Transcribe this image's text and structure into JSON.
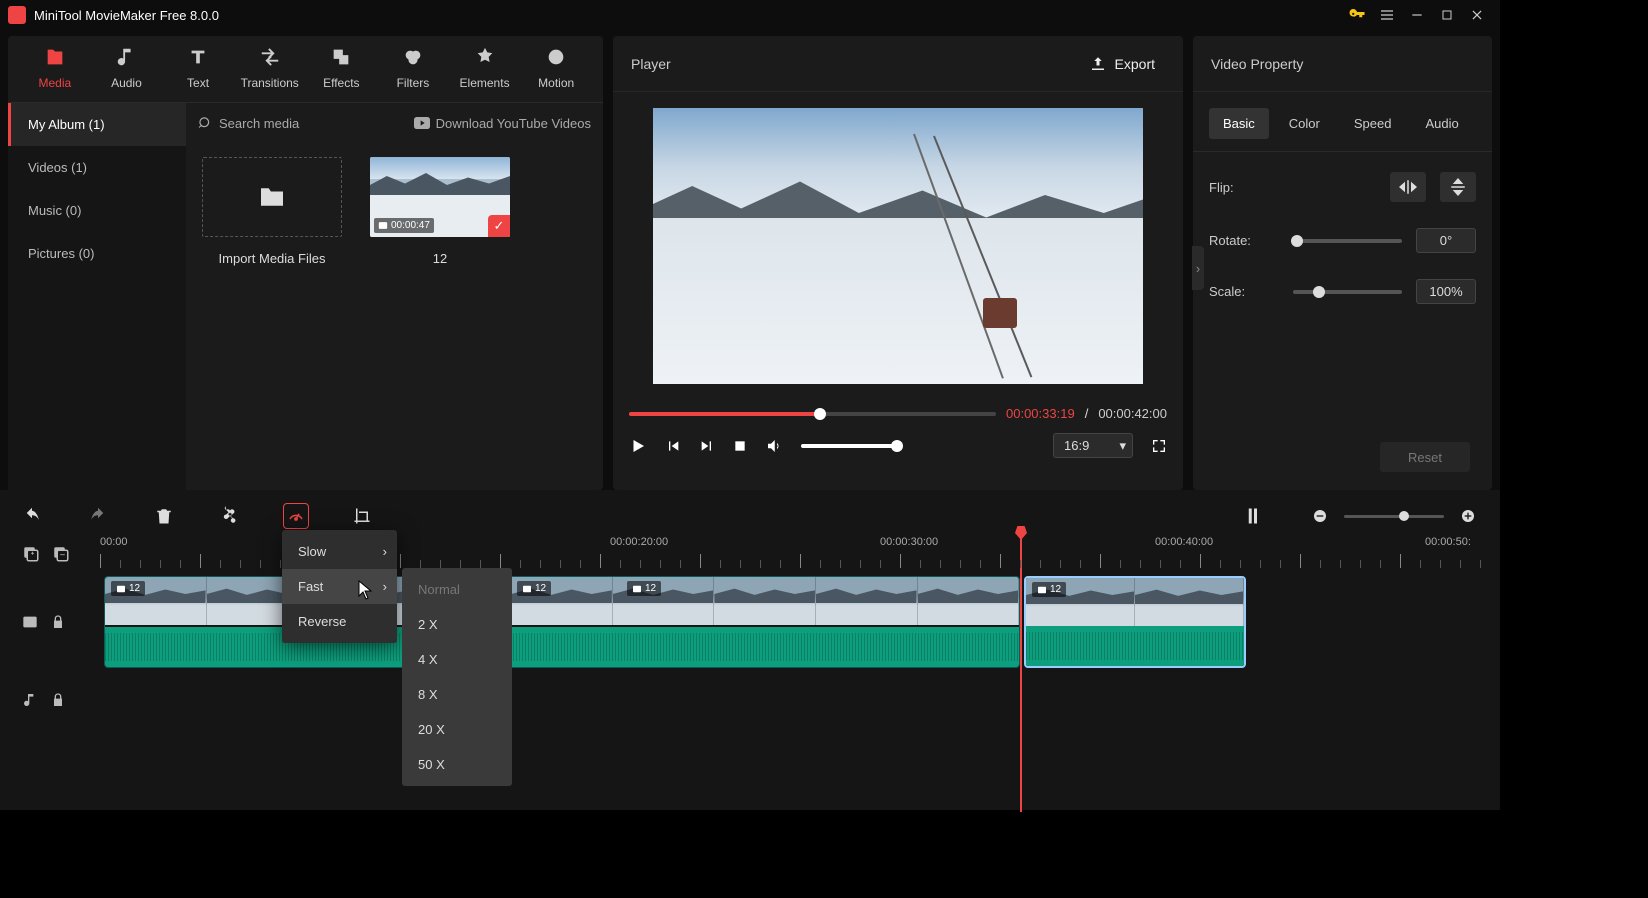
{
  "titlebar": {
    "title": "MiniTool MovieMaker Free 8.0.0"
  },
  "tabs": [
    "Media",
    "Audio",
    "Text",
    "Transitions",
    "Effects",
    "Filters",
    "Elements",
    "Motion"
  ],
  "sidebar": {
    "my_album": "My Album (1)",
    "videos": "Videos (1)",
    "music": "Music (0)",
    "pictures": "Pictures (0)"
  },
  "media_toolbar": {
    "search_placeholder": "Search media",
    "download": "Download YouTube Videos"
  },
  "media": {
    "import_label": "Import Media Files",
    "clip": {
      "duration": "00:00:47",
      "name": "12"
    }
  },
  "player": {
    "title": "Player",
    "export": "Export",
    "time_current": "00:00:33:19",
    "time_sep": " / ",
    "time_total": "00:00:42:00",
    "aspect": "16:9"
  },
  "props": {
    "title": "Video Property",
    "tabs": [
      "Basic",
      "Color",
      "Speed",
      "Audio"
    ],
    "flip": "Flip:",
    "rotate": "Rotate:",
    "rotate_val": "0°",
    "scale": "Scale:",
    "scale_val": "100%",
    "reset": "Reset"
  },
  "ruler": {
    "t0": "00:00",
    "t20": "00:00:20:00",
    "t30": "00:00:30:00",
    "t40": "00:00:40:00",
    "t50": "00:00:50:"
  },
  "speed_menu": {
    "slow": "Slow",
    "fast": "Fast",
    "reverse": "Reverse"
  },
  "fast_sub": {
    "normal": "Normal",
    "x2": "2 X",
    "x4": "4 X",
    "x8": "8 X",
    "x20": "20 X",
    "x50": "50 X"
  },
  "clip_badge": "12"
}
